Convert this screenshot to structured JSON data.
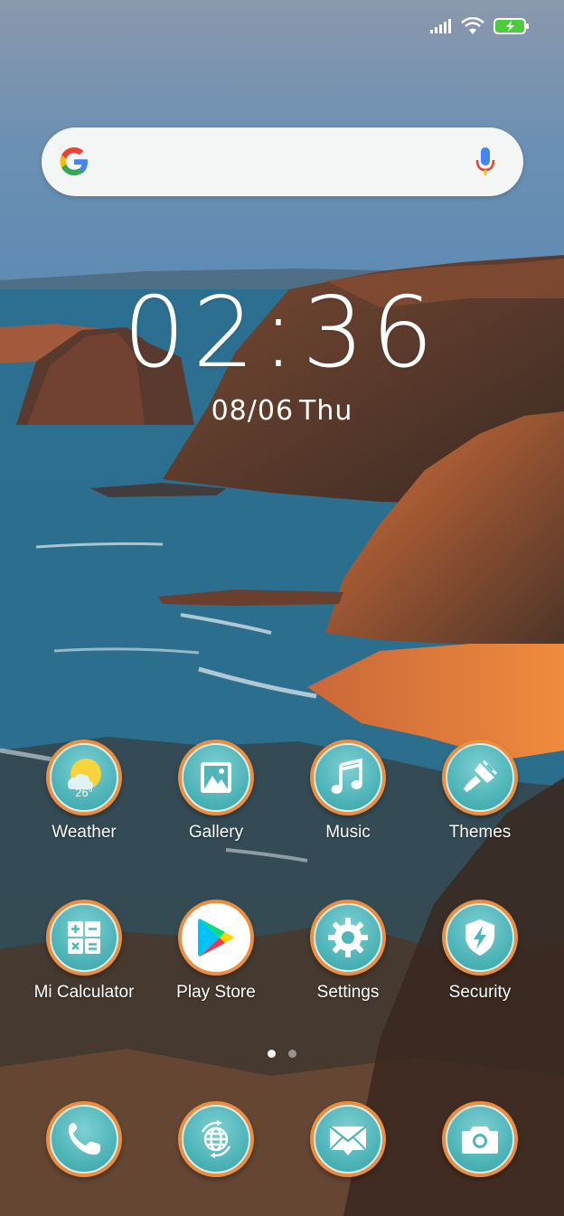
{
  "clock": {
    "time": "02:36",
    "date": "08/06",
    "day": "Thu"
  },
  "apps": [
    {
      "label": "Weather",
      "icon": "weather-icon",
      "temp": "26°"
    },
    {
      "label": "Gallery",
      "icon": "gallery-icon"
    },
    {
      "label": "Music",
      "icon": "music-note-icon"
    },
    {
      "label": "Themes",
      "icon": "paintbrush-icon"
    },
    {
      "label": "Mi Calculator",
      "icon": "calculator-icon"
    },
    {
      "label": "Play Store",
      "icon": "play-store-icon"
    },
    {
      "label": "Settings",
      "icon": "gear-icon"
    },
    {
      "label": "Security",
      "icon": "shield-bolt-icon"
    }
  ],
  "dock": [
    {
      "icon": "phone-icon"
    },
    {
      "icon": "browser-globe-icon"
    },
    {
      "icon": "messages-envelope-icon"
    },
    {
      "icon": "camera-icon"
    }
  ],
  "colors": {
    "icon_ring": "#ec8d3f",
    "icon_fill": "#4fb5b9",
    "search_bar": "#f4f5f5"
  }
}
